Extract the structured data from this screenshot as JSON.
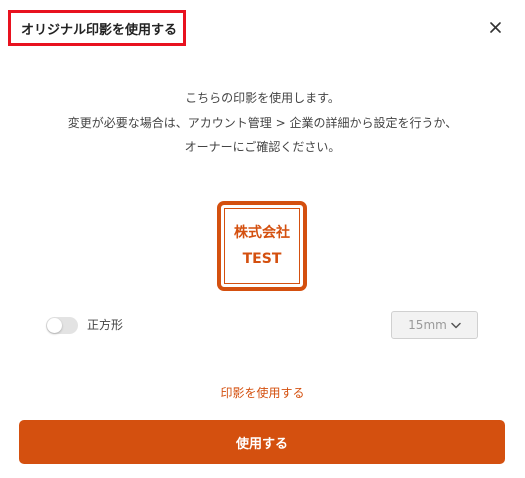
{
  "dialog": {
    "title": "オリジナル印影を使用する",
    "close_icon": "close-icon"
  },
  "description": {
    "line1": "こちらの印影を使用します。",
    "line2": "変更が必要な場合は、アカウント管理 > 企業の詳細から設定を行うか、",
    "line3": "オーナーにご確認ください。"
  },
  "stamp": {
    "line1": "株式会社",
    "line2": "TEST",
    "color": "#d4500f"
  },
  "square_toggle": {
    "label": "正方形",
    "checked": false
  },
  "size_select": {
    "value": "15mm",
    "icon": "chevron-down-icon"
  },
  "use_link": "印影を使用する",
  "use_button": "使用する",
  "colors": {
    "accent": "#d4500f",
    "highlight_border": "#e8121f"
  }
}
